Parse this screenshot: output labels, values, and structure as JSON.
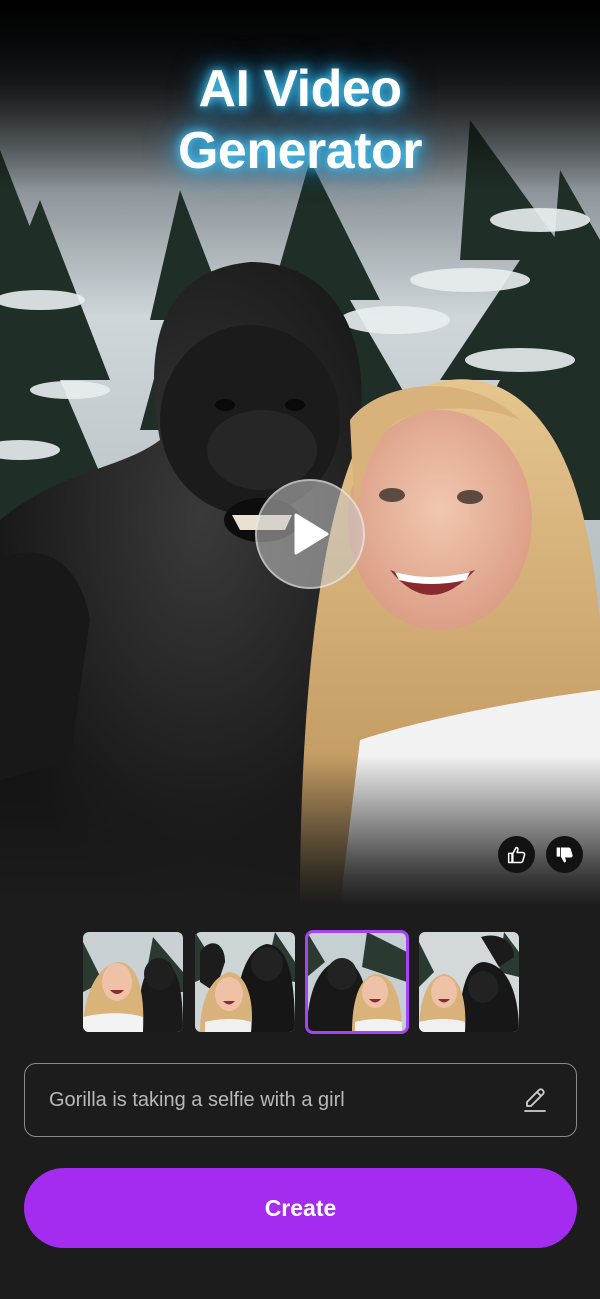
{
  "hero": {
    "title_line1": "AI Video",
    "title_line2": "Generator",
    "glow_color": "#18a8f0"
  },
  "player": {
    "play_icon": "play-icon",
    "like_icon": "thumbs-up-icon",
    "dislike_icon": "thumbs-down-icon"
  },
  "thumbnails": {
    "count": 4,
    "selected_index": 2,
    "selected_color": "#a742f5"
  },
  "prompt": {
    "text": "Gorilla is taking a selfie with a girl",
    "edit_icon": "pencil-icon"
  },
  "create": {
    "label": "Create",
    "color": "#a42cf0"
  }
}
